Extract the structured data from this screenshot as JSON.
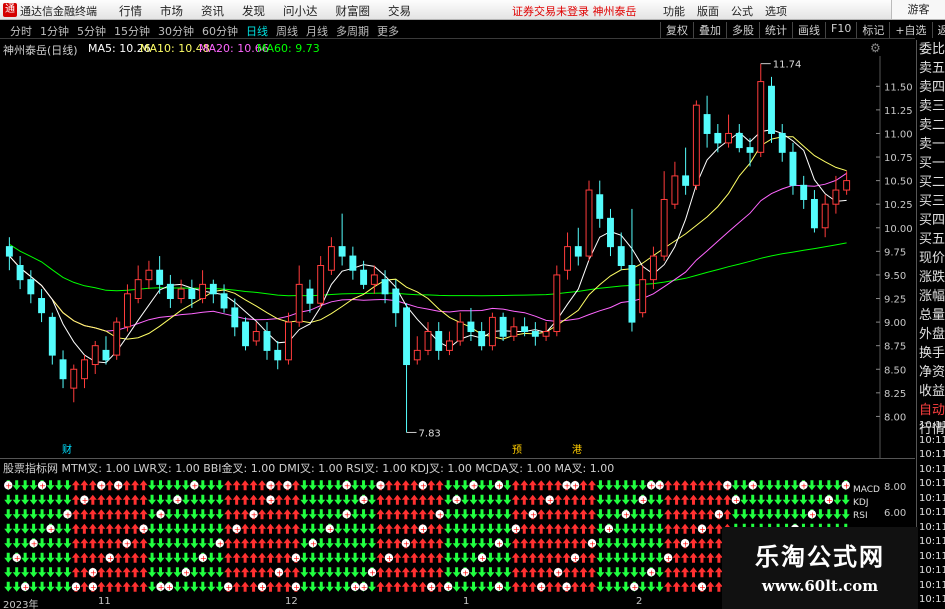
{
  "titlebar": {
    "app_title": "通达信金融终端",
    "menu": [
      "行情",
      "市场",
      "资讯",
      "发现",
      "问小达",
      "财富圈",
      "交易"
    ],
    "notice": "证券交易未登录  神州泰岳",
    "right_menu": [
      "功能",
      "版面",
      "公式",
      "选项"
    ],
    "user_button": "游客"
  },
  "toolbar": {
    "periods": [
      "分时",
      "1分钟",
      "5分钟",
      "15分钟",
      "30分钟",
      "60分钟",
      "日线",
      "周线",
      "月线",
      "多周期",
      "更多"
    ],
    "active_period": "日线",
    "tools": [
      "复权",
      "叠加",
      "多股",
      "统计",
      "画线",
      "F10",
      "标记",
      "+自选",
      "返回"
    ]
  },
  "chart_head": {
    "stock": "神州泰岳(日线)",
    "ma5": "MA5: 10.26",
    "ma10": "MA10: 10.48",
    "ma20": "MA20: 10.66",
    "ma60": "MA60: 9.73",
    "colors": {
      "ma5": "#ffffff",
      "ma10": "#ffff66",
      "ma20": "#ff66ff",
      "ma60": "#00ff00"
    }
  },
  "info_panel": {
    "rows": [
      {
        "label": "委比",
        "tone": "normal"
      },
      {
        "label": "卖五",
        "tone": "normal"
      },
      {
        "label": "卖四",
        "tone": "normal"
      },
      {
        "label": "卖三",
        "tone": "normal"
      },
      {
        "label": "卖二",
        "tone": "normal"
      },
      {
        "label": "卖一",
        "tone": "normal"
      },
      {
        "label": "买一",
        "tone": "normal"
      },
      {
        "label": "买二",
        "tone": "normal"
      },
      {
        "label": "买三",
        "tone": "normal"
      },
      {
        "label": "买四",
        "tone": "normal"
      },
      {
        "label": "买五",
        "tone": "normal"
      },
      {
        "label": "现价",
        "tone": "normal"
      },
      {
        "label": "涨跌",
        "tone": "normal"
      },
      {
        "label": "涨幅",
        "tone": "normal"
      },
      {
        "label": "总量",
        "tone": "normal"
      },
      {
        "label": "外盘",
        "tone": "normal"
      },
      {
        "label": "换手",
        "tone": "normal"
      },
      {
        "label": "净资",
        "tone": "normal"
      },
      {
        "label": "收益",
        "tone": "normal"
      },
      {
        "label": "自动",
        "tone": "red"
      },
      {
        "label": "行情",
        "tone": "normal"
      }
    ],
    "times": [
      "10:11",
      "10:11",
      "10:11",
      "10:11",
      "10:11",
      "10:11",
      "10:11",
      "10:11",
      "10:11",
      "10:11",
      "10:11",
      "10:11",
      "10:11"
    ]
  },
  "price_axis": {
    "ticks": [
      "11.50",
      "11.25",
      "11.00",
      "10.75",
      "10.50",
      "10.25",
      "10.00",
      "9.75",
      "9.50",
      "9.25",
      "9.00",
      "8.75",
      "8.50",
      "8.25",
      "8.00"
    ]
  },
  "annotations": {
    "high_label": "11.74",
    "low_label": "7.83",
    "event_markers": [
      "财",
      "预",
      "港"
    ]
  },
  "indicator": {
    "header": "股票指标网  MTM叉: 1.00  LWR叉: 1.00  BBI金叉: 1.00  DMI叉: 1.00  RSI叉: 1.00  KDJ叉: 1.00  MCDA叉: 1.00  MA叉: 1.00",
    "legend": [
      "MACD",
      "KDJ",
      "RSI"
    ],
    "axis_ticks": [
      "8.00",
      "6.00"
    ]
  },
  "date_axis": {
    "labels": [
      "2023年",
      "11",
      "12",
      "1",
      "2"
    ]
  },
  "watermark": {
    "line1": "乐淘公式网",
    "line2": "www.60lt.com"
  },
  "chart_data": {
    "type": "candlestick",
    "title": "神州泰岳(日线)",
    "ylim": [
      7.75,
      11.8
    ],
    "series": [
      {
        "name": "MA5",
        "color": "#ffffff"
      },
      {
        "name": "MA10",
        "color": "#ffff66"
      },
      {
        "name": "MA20",
        "color": "#ff66ff"
      },
      {
        "name": "MA60",
        "color": "#00ff00"
      }
    ],
    "candles": [
      [
        9.8,
        9.7,
        9.9,
        9.55
      ],
      [
        9.6,
        9.45,
        9.7,
        9.35
      ],
      [
        9.45,
        9.3,
        9.55,
        9.2
      ],
      [
        9.25,
        9.1,
        9.35,
        9.0
      ],
      [
        9.05,
        8.65,
        9.1,
        8.55
      ],
      [
        8.6,
        8.4,
        8.7,
        8.3
      ],
      [
        8.3,
        8.5,
        8.55,
        8.15
      ],
      [
        8.4,
        8.6,
        8.65,
        8.3
      ],
      [
        8.55,
        8.75,
        8.8,
        8.45
      ],
      [
        8.7,
        8.6,
        8.85,
        8.55
      ],
      [
        8.65,
        9.0,
        9.05,
        8.6
      ],
      [
        8.95,
        9.3,
        9.4,
        8.9
      ],
      [
        9.25,
        9.45,
        9.6,
        9.2
      ],
      [
        9.45,
        9.55,
        9.65,
        9.35
      ],
      [
        9.55,
        9.4,
        9.7,
        9.3
      ],
      [
        9.4,
        9.25,
        9.5,
        9.15
      ],
      [
        9.25,
        9.35,
        9.45,
        9.2
      ],
      [
        9.35,
        9.25,
        9.45,
        9.15
      ],
      [
        9.25,
        9.4,
        9.55,
        9.2
      ],
      [
        9.4,
        9.3,
        9.45,
        9.2
      ],
      [
        9.3,
        9.15,
        9.4,
        9.1
      ],
      [
        9.15,
        8.95,
        9.25,
        8.85
      ],
      [
        9.0,
        8.75,
        9.05,
        8.7
      ],
      [
        8.8,
        8.9,
        9.0,
        8.75
      ],
      [
        8.9,
        8.7,
        9.0,
        8.6
      ],
      [
        8.7,
        8.6,
        8.8,
        8.5
      ],
      [
        8.6,
        9.0,
        9.1,
        8.55
      ],
      [
        9.0,
        9.4,
        9.6,
        8.95
      ],
      [
        9.35,
        9.2,
        9.45,
        9.1
      ],
      [
        9.2,
        9.6,
        9.7,
        9.15
      ],
      [
        9.55,
        9.8,
        9.9,
        9.5
      ],
      [
        9.8,
        9.7,
        10.15,
        9.6
      ],
      [
        9.7,
        9.55,
        9.8,
        9.45
      ],
      [
        9.55,
        9.4,
        9.65,
        9.35
      ],
      [
        9.4,
        9.5,
        9.6,
        9.3
      ],
      [
        9.45,
        9.3,
        9.55,
        9.2
      ],
      [
        9.35,
        9.1,
        9.45,
        8.95
      ],
      [
        9.15,
        8.55,
        9.2,
        7.83
      ],
      [
        8.6,
        8.7,
        8.85,
        8.55
      ],
      [
        8.7,
        8.9,
        9.0,
        8.65
      ],
      [
        8.9,
        8.7,
        9.0,
        8.6
      ],
      [
        8.7,
        8.8,
        8.9,
        8.65
      ],
      [
        8.8,
        9.0,
        9.1,
        8.75
      ],
      [
        9.0,
        8.9,
        9.15,
        8.8
      ],
      [
        8.9,
        8.75,
        9.0,
        8.7
      ],
      [
        8.75,
        9.05,
        9.1,
        8.7
      ],
      [
        9.05,
        8.85,
        9.1,
        8.8
      ],
      [
        8.85,
        8.95,
        9.05,
        8.8
      ],
      [
        8.95,
        8.9,
        9.05,
        8.85
      ],
      [
        8.9,
        8.85,
        9.0,
        8.75
      ],
      [
        8.85,
        8.9,
        9.0,
        8.8
      ],
      [
        8.9,
        9.5,
        9.6,
        8.85
      ],
      [
        9.55,
        9.8,
        9.95,
        9.45
      ],
      [
        9.8,
        9.7,
        10.0,
        9.6
      ],
      [
        9.7,
        10.4,
        10.5,
        9.65
      ],
      [
        10.35,
        10.1,
        10.5,
        10.0
      ],
      [
        10.1,
        9.8,
        10.2,
        9.7
      ],
      [
        9.8,
        9.6,
        9.95,
        9.55
      ],
      [
        9.6,
        9.0,
        10.2,
        8.9
      ],
      [
        9.1,
        9.45,
        9.6,
        9.05
      ],
      [
        9.45,
        9.7,
        9.8,
        9.35
      ],
      [
        9.7,
        10.3,
        10.6,
        9.65
      ],
      [
        10.25,
        10.55,
        10.7,
        10.2
      ],
      [
        10.55,
        10.45,
        10.85,
        10.35
      ],
      [
        10.45,
        11.3,
        11.35,
        10.4
      ],
      [
        11.2,
        11.0,
        11.4,
        10.85
      ],
      [
        11.0,
        10.9,
        11.1,
        10.8
      ],
      [
        10.9,
        11.0,
        11.2,
        10.85
      ],
      [
        11.0,
        10.85,
        11.1,
        10.8
      ],
      [
        10.85,
        10.8,
        10.95,
        10.65
      ],
      [
        10.8,
        11.55,
        11.74,
        10.75
      ],
      [
        11.5,
        11.0,
        11.6,
        10.9
      ],
      [
        11.0,
        10.8,
        11.1,
        10.7
      ],
      [
        10.8,
        10.45,
        10.9,
        10.35
      ],
      [
        10.45,
        10.3,
        10.55,
        10.2
      ],
      [
        10.3,
        10.0,
        10.4,
        9.95
      ],
      [
        10.0,
        10.25,
        10.35,
        9.9
      ],
      [
        10.25,
        10.4,
        10.55,
        10.15
      ],
      [
        10.4,
        10.5,
        10.6,
        10.35
      ]
    ]
  }
}
